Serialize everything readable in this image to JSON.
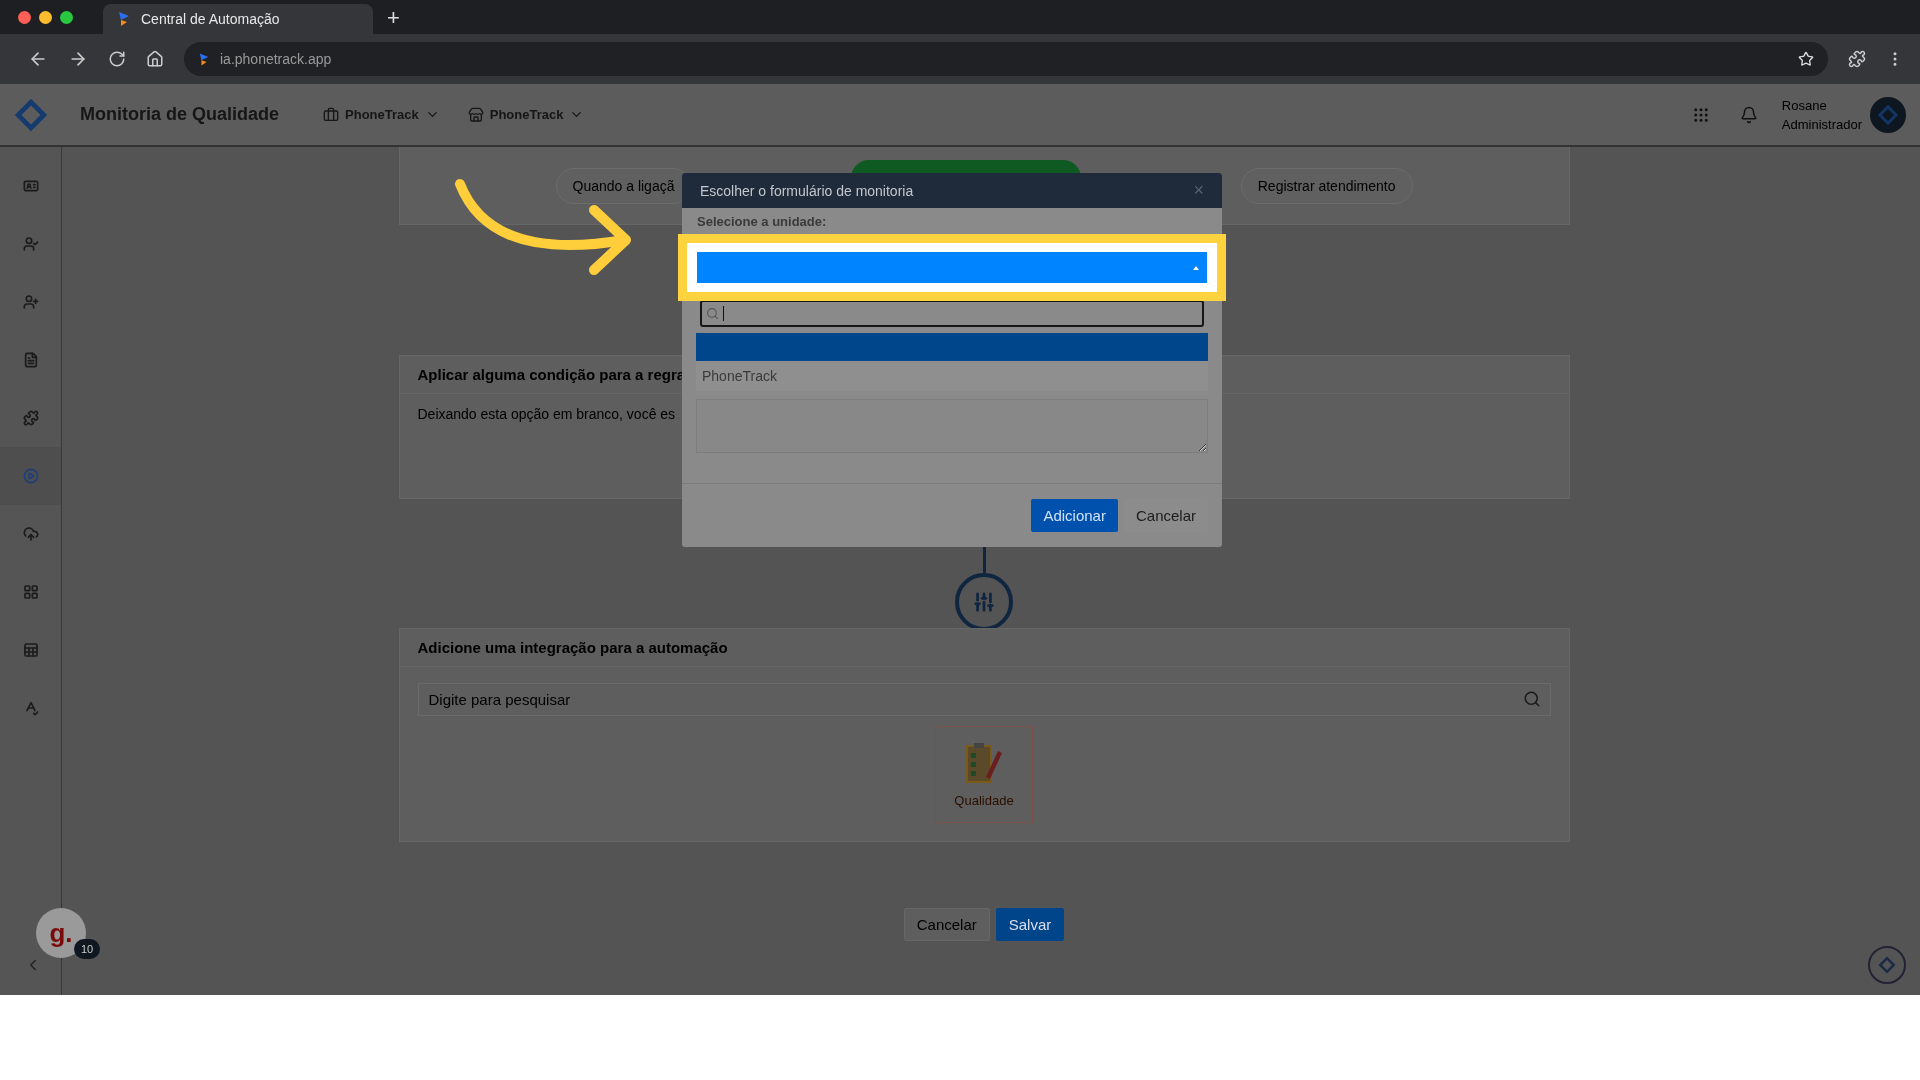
{
  "browser": {
    "tab_title": "Central de Automação",
    "new_tab": "+",
    "url": "ia.phonetrack.app"
  },
  "header": {
    "title": "Monitoria de Qualidade",
    "selectors": [
      {
        "kind": "briefcase",
        "label": "PhoneTrack"
      },
      {
        "kind": "store",
        "label": "PhoneTrack"
      }
    ],
    "user": {
      "name": "Rosane",
      "role": "Administrador"
    }
  },
  "sidebar": {
    "items": [
      {
        "kind": "idcard",
        "selected": false
      },
      {
        "kind": "usercheck",
        "selected": false
      },
      {
        "kind": "userplus",
        "selected": false
      },
      {
        "kind": "file",
        "selected": false
      },
      {
        "kind": "puzzle",
        "selected": false
      },
      {
        "kind": "play",
        "selected": true
      },
      {
        "kind": "cloud",
        "selected": false
      },
      {
        "kind": "grid",
        "selected": false
      },
      {
        "kind": "table",
        "selected": false
      },
      {
        "kind": "spell",
        "selected": false
      }
    ]
  },
  "steps": [
    {
      "label": "Quando a ligaçã"
    },
    {
      "label": "Registrar atendimento"
    }
  ],
  "condition": {
    "title": "Aplicar alguma condição para a regra",
    "hint": "Deixando esta opção em branco, você es"
  },
  "integration": {
    "title": "Adicione uma integração para a automação",
    "search_placeholder": "Digite para pesquisar",
    "items": [
      {
        "label": "Qualidade"
      }
    ]
  },
  "footer_buttons": [
    {
      "kind": "secondary",
      "label": "Cancelar"
    },
    {
      "kind": "primary",
      "label": "Salvar"
    }
  ],
  "modal": {
    "title": "Escolher o formulário de monitoria",
    "close": "×",
    "field_label": "Selecione a unidade:",
    "options": [
      {
        "selected": true
      },
      {
        "label": "PhoneTrack",
        "selected": false
      }
    ],
    "buttons": [
      {
        "kind": "primary",
        "label": "Adicionar"
      },
      {
        "kind": "secondary",
        "label": "Cancelar"
      }
    ]
  },
  "chat_widget": {
    "letter": "g.",
    "badge": "10"
  }
}
